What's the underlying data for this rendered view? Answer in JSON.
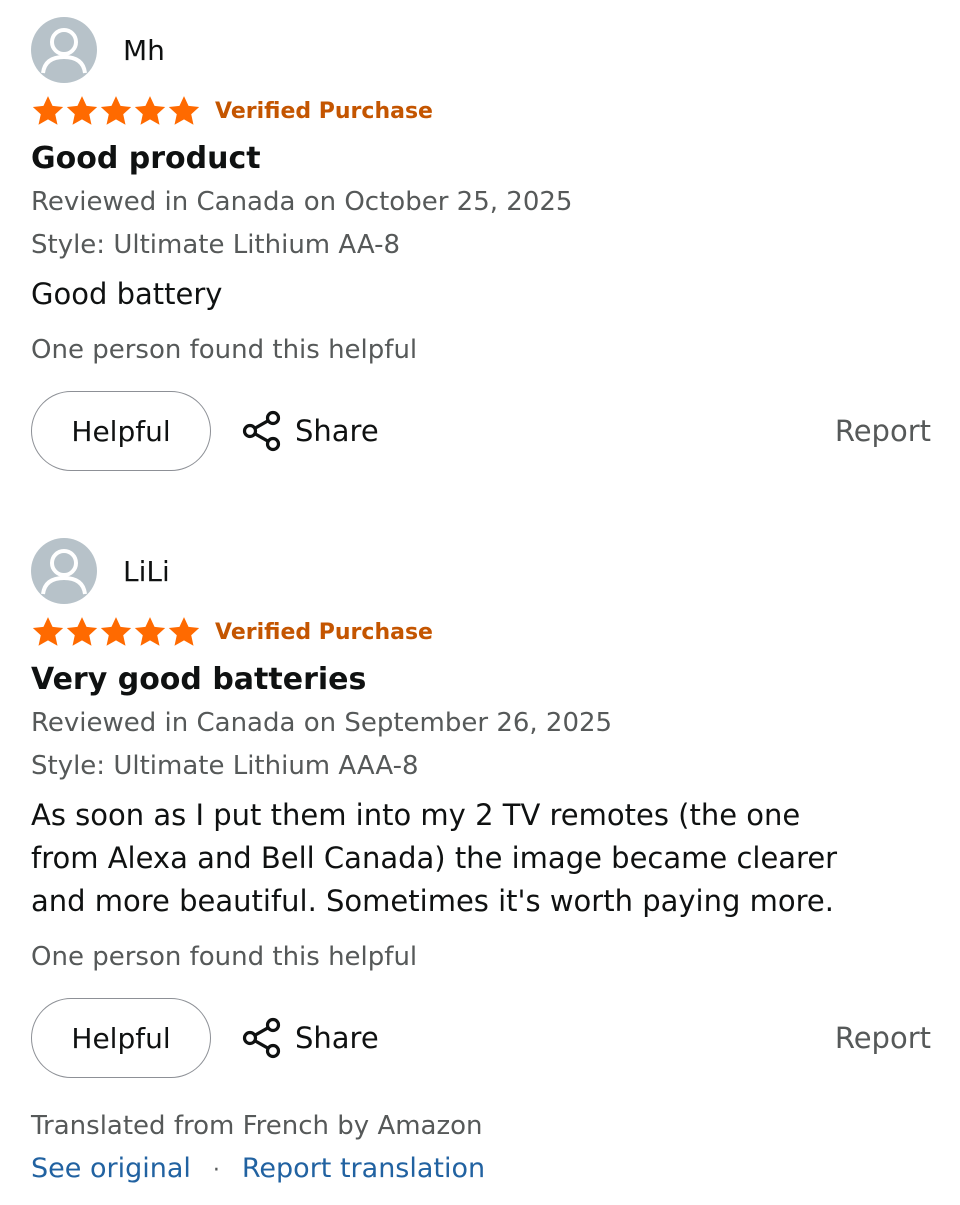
{
  "reviews": [
    {
      "profile_name": "Mh",
      "rating": 5,
      "rating_max": 5,
      "verified_label": "Verified Purchase",
      "title": "Good product",
      "reviewed_line": "Reviewed in Canada on October 25, 2025",
      "style_line": "Style: Ultimate Lithium AA-8",
      "body": "Good battery",
      "helpful_count_text": "One person found this helpful",
      "helpful_button": "Helpful",
      "share_label": "Share",
      "report_label": "Report"
    },
    {
      "profile_name": "LiLi",
      "rating": 5,
      "rating_max": 5,
      "verified_label": "Verified Purchase",
      "title": "Very good batteries",
      "reviewed_line": "Reviewed in Canada on September 26, 2025",
      "style_line": "Style: Ultimate Lithium AAA-8",
      "body": "As soon as I put them into my 2 TV remotes (the one\nfrom Alexa and Bell Canada) the image became clearer\nand more beautiful. Sometimes it's worth paying more.",
      "helpful_count_text": "One person found this helpful",
      "helpful_button": "Helpful",
      "share_label": "Share",
      "report_label": "Report"
    }
  ],
  "translation": {
    "note": "Translated from French by Amazon",
    "see_original": "See original",
    "separator": "·",
    "report_translation": "Report translation"
  },
  "colors": {
    "star": "#ff6a00",
    "verified": "#c45500",
    "link": "#2162a1",
    "secondary_text": "#565959"
  },
  "icons": {
    "avatar": "person-avatar-icon",
    "star": "star-icon",
    "share": "share-icon"
  }
}
